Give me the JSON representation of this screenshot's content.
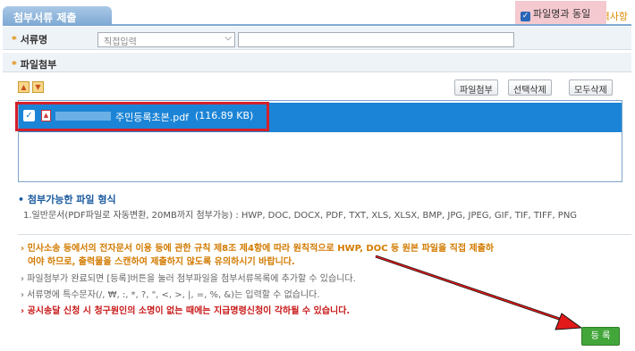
{
  "header": {
    "tab_title": "첨부서류 제출",
    "required_note": "• 필수입력사항"
  },
  "doc_row": {
    "label": "서류명",
    "select_value": "직접입력",
    "input_value": "",
    "checkbox_label": "파일명과 동일",
    "checkbox_checked": true
  },
  "attach_row": {
    "label": "파일첨부"
  },
  "toolbar": {
    "attach": "파일첨부",
    "delete_selected": "선택삭제",
    "delete_all": "모두삭제"
  },
  "file_item": {
    "name": "주민등록초본.pdf",
    "size": "(116.89 KB)",
    "checked": true
  },
  "formats": {
    "title": "첨부가능한 파일 형식",
    "list": "1.일반문서(PDF파일로 자동변환, 20MB까지 첨부가능) : HWP, DOC, DOCX, PDF, TXT, XLS, XLSX, BMP, JPG, JPEG, GIF, TIF, TIFF, PNG"
  },
  "notes": [
    "› 민사소송 등에서의 전자문서 이용 등에 관한 규칙 제8조 제4항에 따라 원칙적으로 HWP, DOC 등 원본 파일을 직접 제출하",
    "여야 하므로, 출력물을 스캔하여 제출하지 않도록 유의하시기 바랍니다.",
    "› 파일첨부가 완료되면 [등록]버튼을 눌러 첨부파일을 첨부서류목록에 추가할 수 있습니다.",
    "› 서류명에 특수문자(/, ₩, :, *, ?, \", <, >, |, =, %, &)는 입력할 수 없습니다.",
    "› 공시송달 신청 시 청구원인의 소명이 없는 때에는 지급명령신청이 각하될 수 있습니다."
  ],
  "register_button": "등 록",
  "colors": {
    "accent": "#1c84d6",
    "highlight": "#d4212b",
    "green": "#42a63a",
    "orange": "#d27b00"
  }
}
